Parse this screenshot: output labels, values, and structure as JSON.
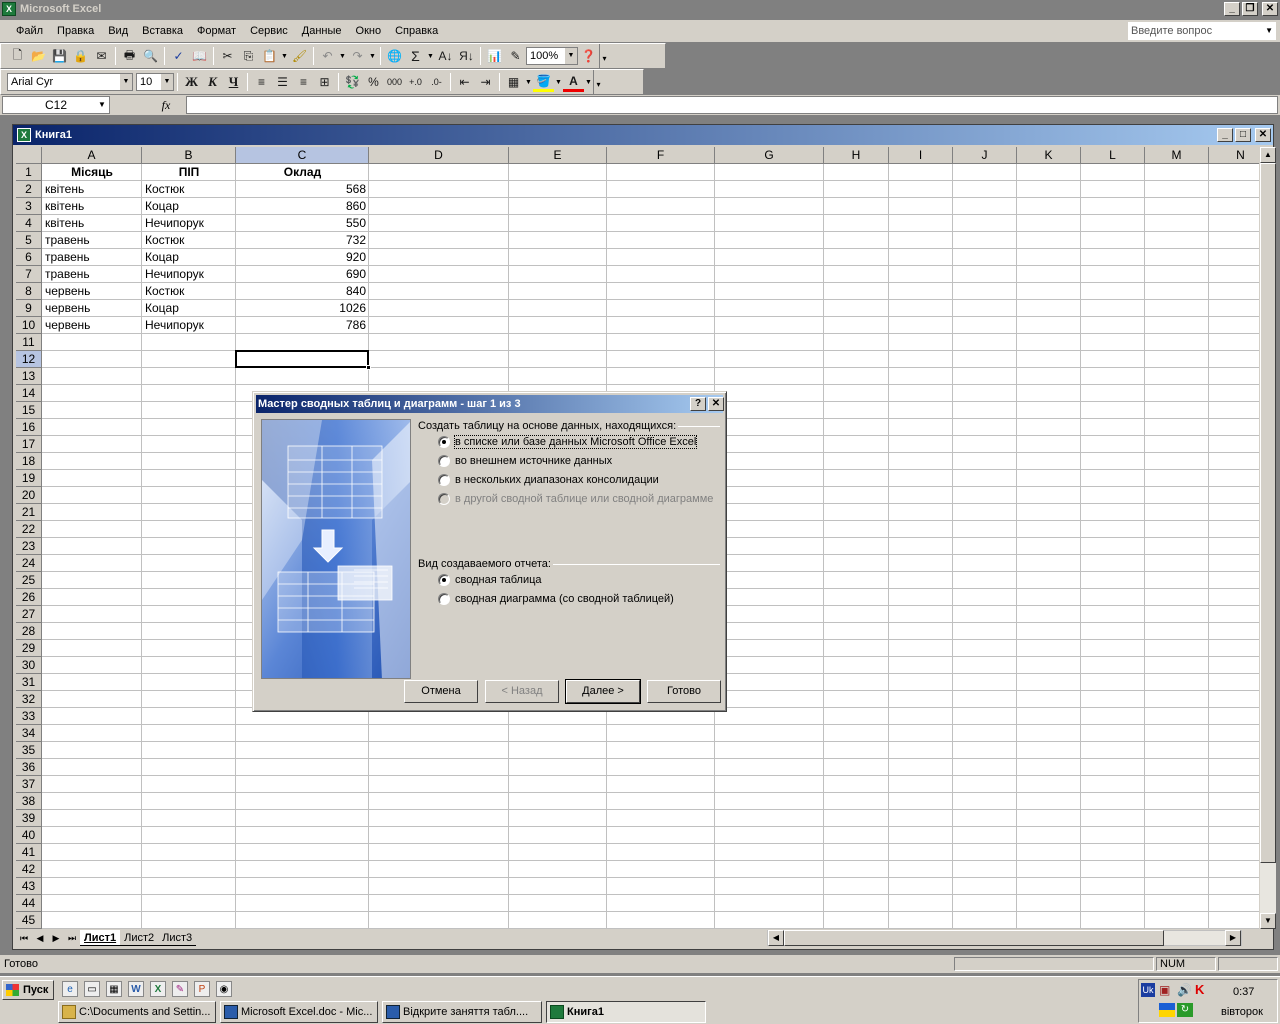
{
  "app": {
    "title": "Microsoft Excel"
  },
  "menu": [
    "Файл",
    "Правка",
    "Вид",
    "Вставка",
    "Формат",
    "Сервис",
    "Данные",
    "Окно",
    "Справка"
  ],
  "help_placeholder": "Введите вопрос",
  "toolbar": {
    "zoom": "100%",
    "font_name": "Arial Cyr",
    "font_size": "10",
    "bold": "Ж",
    "italic": "К",
    "underline": "Ч",
    "percent": "%",
    "thousands": "000",
    "sum": "Σ"
  },
  "formula_bar": {
    "name_box": "C12",
    "fx": "fx",
    "value": ""
  },
  "workbook": {
    "title": "Книга1"
  },
  "columns": [
    "A",
    "B",
    "C",
    "D",
    "E",
    "F",
    "G",
    "H",
    "I",
    "J",
    "K",
    "L",
    "M",
    "N"
  ],
  "selected_cell": {
    "col": "C",
    "row": 12
  },
  "rows": [
    [
      "Місяць",
      "ПІП",
      "Оклад"
    ],
    [
      "квітень",
      "Костюк",
      "568"
    ],
    [
      "квітень",
      "Коцар",
      "860"
    ],
    [
      "квітень",
      "Нечипорук",
      "550"
    ],
    [
      "травень",
      "Костюк",
      "732"
    ],
    [
      "травень",
      "Коцар",
      "920"
    ],
    [
      "травень",
      "Нечипорук",
      "690"
    ],
    [
      "червень",
      "Костюк",
      "840"
    ],
    [
      "червень",
      "Коцар",
      "1026"
    ],
    [
      "червень",
      "Нечипорук",
      "786"
    ]
  ],
  "sheets": [
    "Лист1",
    "Лист2",
    "Лист3"
  ],
  "status": {
    "text": "Готово",
    "num": "NUM"
  },
  "dialog": {
    "title": "Мастер сводных таблиц и диаграмм - шаг 1 из 3",
    "source_label": "Создать таблицу на основе данных, находящихся:",
    "source_options": [
      {
        "label": "в списке или базе данных Microsoft Office Excel",
        "checked": true,
        "disabled": false
      },
      {
        "label": "во внешнем источнике данных",
        "checked": false,
        "disabled": false
      },
      {
        "label": "в нескольких диапазонах консолидации",
        "checked": false,
        "disabled": false
      },
      {
        "label": "в другой сводной таблице или сводной диаграмме",
        "checked": false,
        "disabled": true
      }
    ],
    "report_label": "Вид создаваемого отчета:",
    "report_options": [
      {
        "label": "сводная таблица",
        "checked": true
      },
      {
        "label": "сводная диаграмма (со сводной таблицей)",
        "checked": false
      }
    ],
    "buttons": {
      "cancel": "Отмена",
      "back": "< Назад",
      "next": "Далее >",
      "finish": "Готово"
    }
  },
  "taskbar": {
    "start": "Пуск",
    "tasks": [
      "C:\\Documents and Settin...",
      "Microsoft Excel.doc - Mic...",
      "Відкрите заняття табл....",
      "Книга1"
    ],
    "tray_lang": "Uk",
    "time": "0:37",
    "day": "вівторок"
  }
}
